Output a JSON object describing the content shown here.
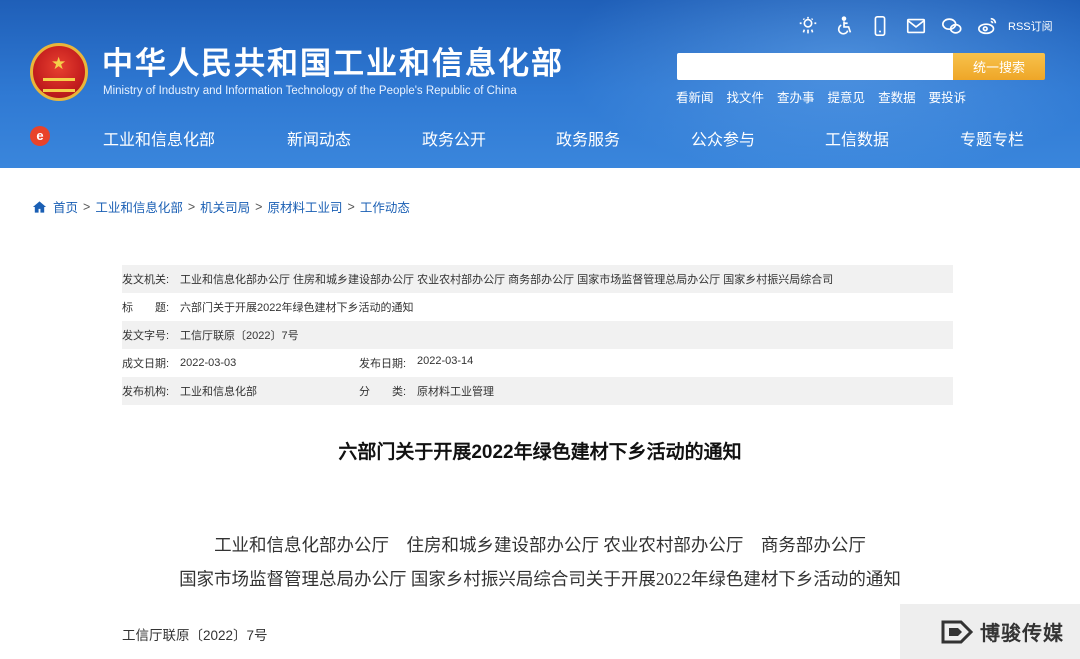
{
  "header": {
    "title_cn": "中华人民共和国工业和信息化部",
    "title_en": "Ministry of Industry and Information Technology of the People's Republic of China",
    "top_icons": [
      "weather-icon",
      "accessibility-icon",
      "mobile-icon",
      "mail-icon",
      "wechat-icon",
      "weibo-icon"
    ],
    "rss_label": "RSS订阅",
    "search": {
      "placeholder": "",
      "button_label": "统一搜索"
    },
    "quick_links": [
      "看新闻",
      "找文件",
      "查办事",
      "提意见",
      "查数据",
      "要投诉"
    ],
    "nav_logo_glyph": "e",
    "nav": [
      "工业和信息化部",
      "新闻动态",
      "政务公开",
      "政务服务",
      "公众参与",
      "工信数据",
      "专题专栏"
    ],
    "colors": {
      "header_top": "#1f5fb8",
      "header_bottom": "#3a86dc",
      "search_button": "#f0ad2e",
      "link_blue": "#1a5fb4"
    }
  },
  "breadcrumb": [
    "首页",
    "工业和信息化部",
    "机关司局",
    "原材料工业司",
    "工作动态"
  ],
  "meta": {
    "issuer_label": "发文机关:",
    "issuer_value": "工业和信息化部办公厅 住房和城乡建设部办公厅 农业农村部办公厅 商务部办公厅 国家市场监督管理总局办公厅 国家乡村振兴局综合司",
    "title_label": "标　　题:",
    "title_value": "六部门关于开展2022年绿色建材下乡活动的通知",
    "docno_label": "发文字号:",
    "docno_value": "工信厅联原〔2022〕7号",
    "created_label": "成文日期:",
    "created_value": "2022-03-03",
    "published_label": "发布日期:",
    "published_value": "2022-03-14",
    "agency_label": "发布机构:",
    "agency_value": "工业和信息化部",
    "category_label": "分　　类:",
    "category_value": "原材料工业管理"
  },
  "article": {
    "title": "六部门关于开展2022年绿色建材下乡活动的通知",
    "intro_line1": "工业和信息化部办公厅　住房和城乡建设部办公厅 农业农村部办公厅　商务部办公厅",
    "intro_line2": "国家市场监督管理总局办公厅 国家乡村振兴局综合司关于开展2022年绿色建材下乡活动的通知",
    "doc_no": "工信厅联原〔2022〕7号"
  },
  "watermark": {
    "text": "博骏传媒"
  }
}
